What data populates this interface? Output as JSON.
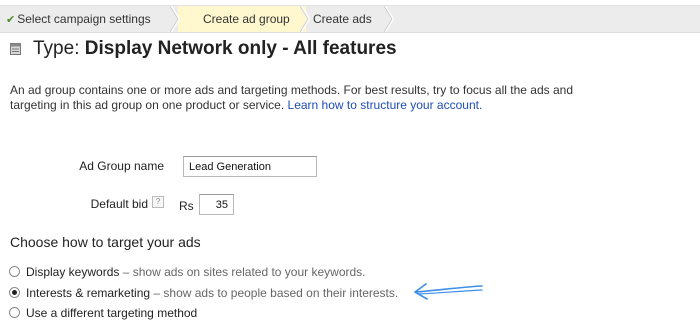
{
  "breadcrumb": {
    "steps": [
      {
        "label": "Select campaign settings",
        "state": "done"
      },
      {
        "label": "Create ad group",
        "state": "active"
      },
      {
        "label": "Create ads",
        "state": "pending"
      }
    ]
  },
  "header": {
    "type_prefix": "Type:",
    "type_value": "Display Network only - All features"
  },
  "description": {
    "text": "An ad group contains one or more ads and targeting methods. For best results, try to focus all the ads and targeting in this ad group on one product or service.",
    "link": "Learn how to structure your account."
  },
  "form": {
    "ad_group_name_label": "Ad Group name",
    "ad_group_name_value": "Lead Generation",
    "default_bid_label": "Default bid",
    "help_glyph": "?",
    "currency": "Rs",
    "default_bid_value": "35"
  },
  "targeting": {
    "heading": "Choose how to target your ads",
    "options": [
      {
        "label": "Display keywords",
        "desc": " – show ads on sites related to your keywords.",
        "selected": false
      },
      {
        "label": "Interests & remarketing",
        "desc": " – show ads to people based on their interests.",
        "selected": true
      },
      {
        "label": "Use a different targeting method",
        "desc": "",
        "selected": false
      }
    ]
  },
  "colors": {
    "link": "#1e4eb5",
    "active_step_bg": "#fff8cf",
    "annotation_arrow": "#3d8ee8"
  },
  "icons": {
    "check": "check-icon",
    "title": "folder-icon",
    "help": "help-icon",
    "annotation": "arrow-annotation-icon"
  }
}
